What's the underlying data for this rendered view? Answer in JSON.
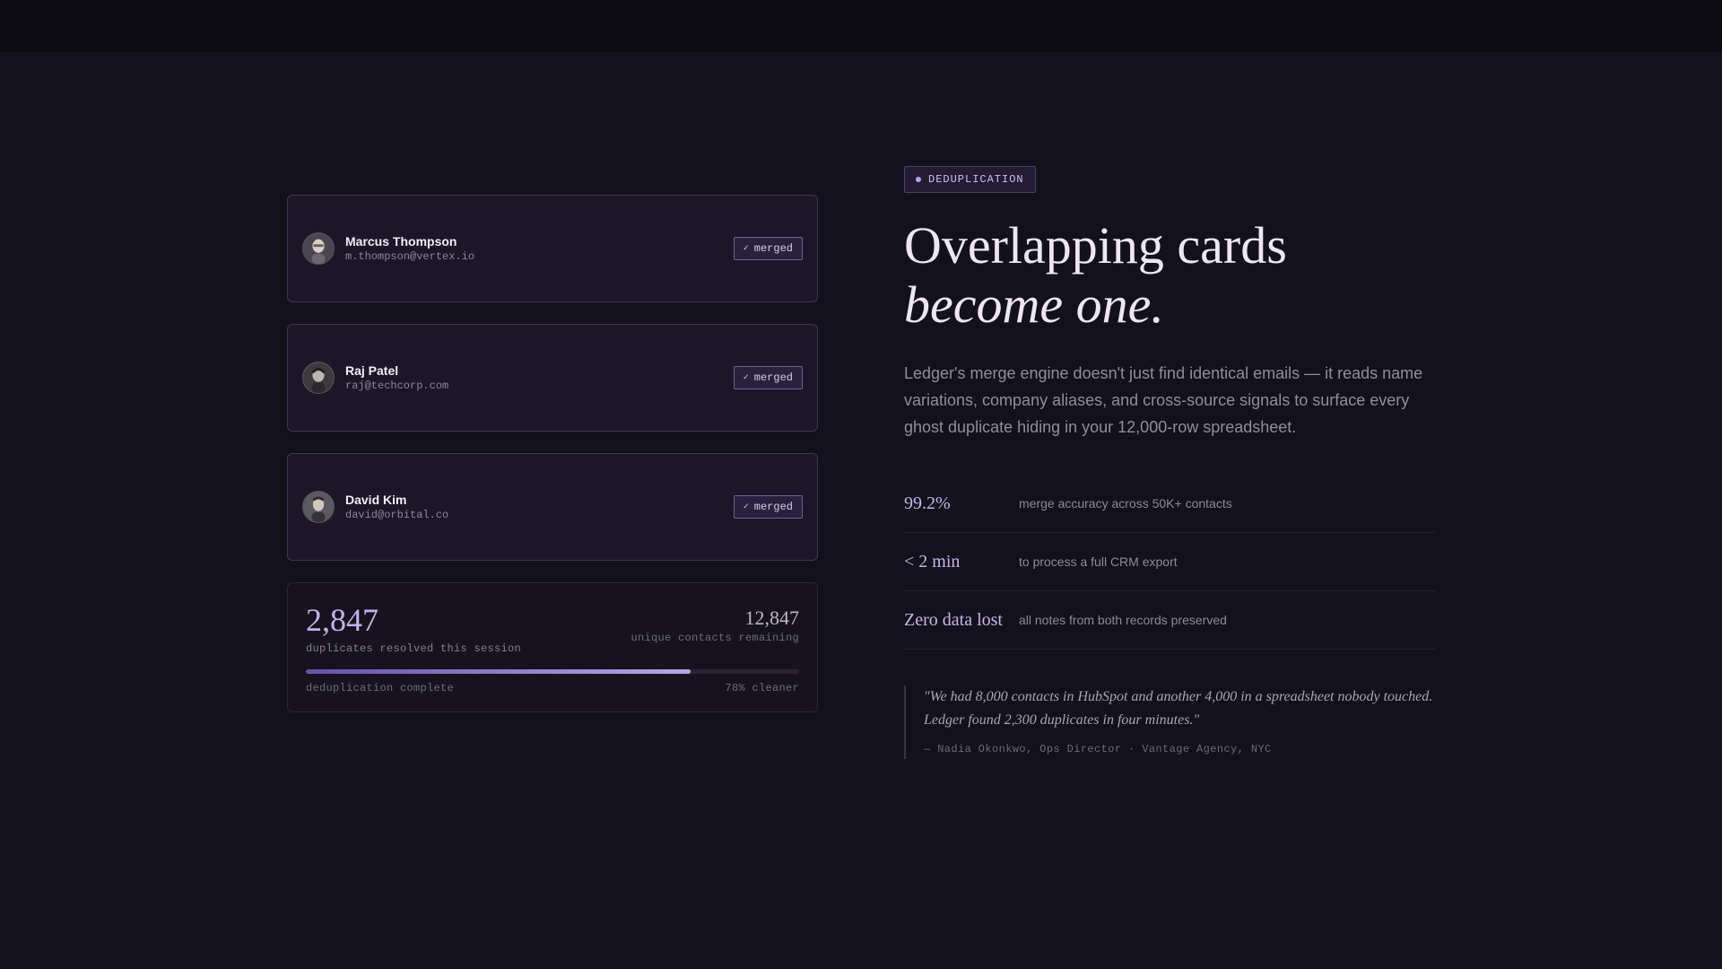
{
  "contacts": [
    {
      "name": "Marcus Thompson",
      "email": "m.thompson@vertex.io",
      "badge": "merged"
    },
    {
      "name": "Raj Patel",
      "email": "raj@techcorp.com",
      "badge": "merged"
    },
    {
      "name": "David Kim",
      "email": "david@orbital.co",
      "badge": "merged"
    }
  ],
  "session_stats": {
    "resolved_value": "2,847",
    "resolved_label": "duplicates resolved this session",
    "unique_value": "12,847",
    "unique_label": "unique contacts remaining",
    "progress_fraction": 0.78,
    "progress_label": "deduplication complete",
    "progress_right_label": "78% cleaner"
  },
  "hero": {
    "tag": "DEDUPLICATION",
    "headline_line1": "Overlapping cards",
    "headline_line2": "become one.",
    "description": "Ledger's merge engine doesn't just find identical emails — it reads name variations, company aliases, and cross-source signals to surface every ghost duplicate hiding in your 12,000-row spreadsheet."
  },
  "metrics": [
    {
      "value": "99.2%",
      "label": "merge accuracy across 50K+ contacts"
    },
    {
      "value": "< 2 min",
      "label": "to process a full CRM export"
    },
    {
      "value": "Zero data lost",
      "label": "all notes from both records preserved"
    }
  ],
  "testimonial": {
    "quote": "\"We had 8,000 contacts in HubSpot and another 4,000 in a spreadsheet nobody touched. Ledger found 2,300 duplicates in four minutes.\"",
    "attribution": "— Nadia Okonkwo, Ops Director · Vantage Agency, NYC"
  },
  "colors": {
    "background": "#13111c",
    "accent": "#c4b2ea",
    "card": "#1c1628"
  },
  "icons": {
    "check": "check-icon",
    "tag_dot": "dot-icon"
  }
}
